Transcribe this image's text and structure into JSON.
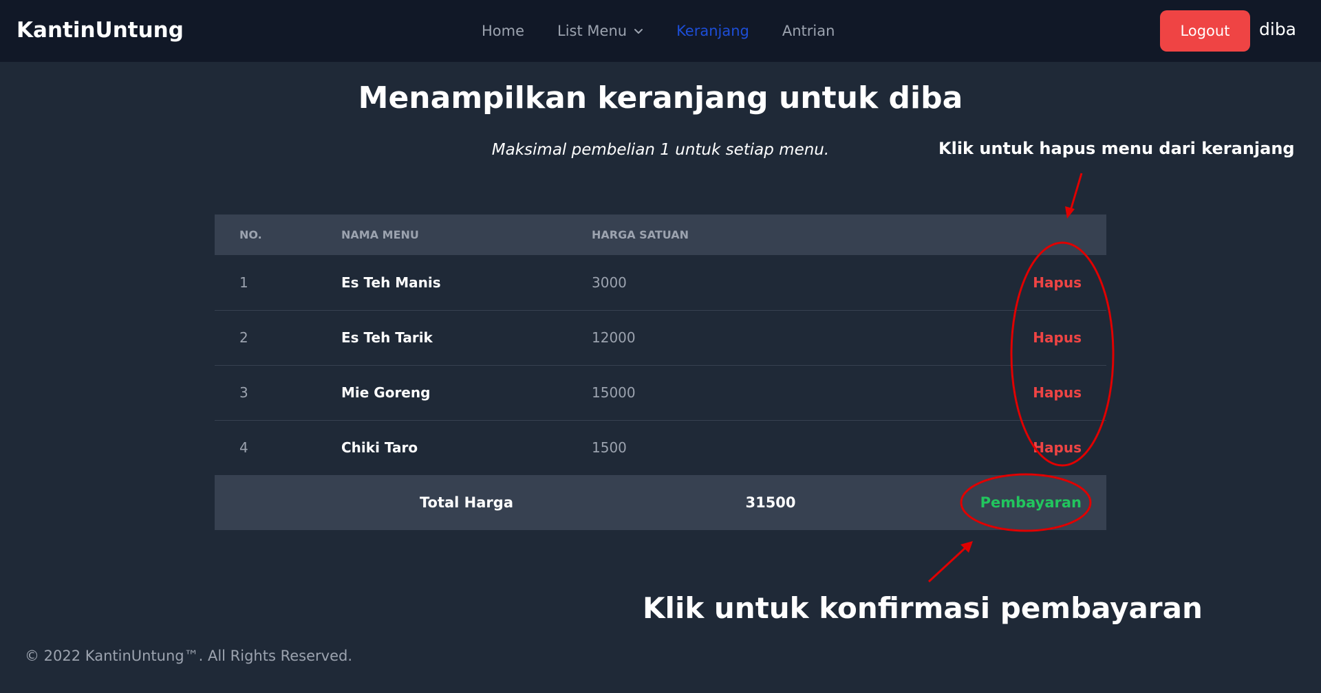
{
  "navbar": {
    "brand": "KantinUntung",
    "links": {
      "home": "Home",
      "list_menu": "List Menu",
      "keranjang": "Keranjang",
      "antrian": "Antrian"
    },
    "logout_label": "Logout",
    "user_name": "diba"
  },
  "page": {
    "title": "Menampilkan keranjang untuk diba",
    "subtitle": "Maksimal pembelian 1 untuk setiap menu."
  },
  "table": {
    "headers": {
      "no": "NO.",
      "name": "NAMA MENU",
      "price": "HARGA SATUAN"
    },
    "rows": [
      {
        "no": "1",
        "name": "Es Teh Manis",
        "price": "3000",
        "action": "Hapus"
      },
      {
        "no": "2",
        "name": "Es Teh Tarik",
        "price": "12000",
        "action": "Hapus"
      },
      {
        "no": "3",
        "name": "Mie Goreng",
        "price": "15000",
        "action": "Hapus"
      },
      {
        "no": "4",
        "name": "Chiki Taro",
        "price": "1500",
        "action": "Hapus"
      }
    ],
    "footer": {
      "total_label": "Total Harga",
      "total_value": "31500",
      "pay_label": "Pembayaran"
    }
  },
  "annotations": {
    "top": "Klik untuk hapus menu dari keranjang",
    "bottom": "Klik untuk konfirmasi pembayaran"
  },
  "footer": {
    "copyright": "© 2022 KantinUntung™. All Rights Reserved."
  },
  "colors": {
    "background": "#1f2937",
    "navbar": "#111827",
    "accent_active": "#1d4ed8",
    "danger": "#ef4444",
    "success": "#22c55e",
    "annotation": "#e00000"
  }
}
